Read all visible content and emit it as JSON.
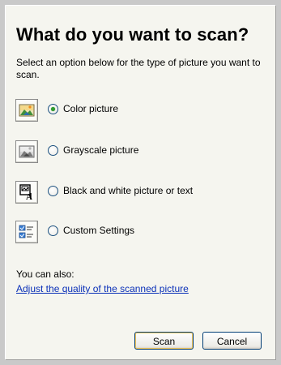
{
  "dialog": {
    "title": "What do you want to scan?",
    "instructions": "Select an option below for the type of picture you want to scan."
  },
  "options": [
    {
      "label": "Color picture",
      "icon": "color-picture-icon",
      "selected": true
    },
    {
      "label": "Grayscale picture",
      "icon": "grayscale-picture-icon",
      "selected": false
    },
    {
      "label": "Black and white picture or text",
      "icon": "black-white-text-icon",
      "selected": false
    },
    {
      "label": "Custom Settings",
      "icon": "custom-settings-icon",
      "selected": false
    }
  ],
  "also": {
    "label": "You can also:",
    "link": "Adjust the quality of the scanned picture"
  },
  "buttons": {
    "scan": "Scan",
    "cancel": "Cancel"
  },
  "colors": {
    "panel_background": "#f5f5ef",
    "link": "#0a30b8",
    "radio_selected": "#2f9b2f",
    "button_border": "#003c74"
  }
}
